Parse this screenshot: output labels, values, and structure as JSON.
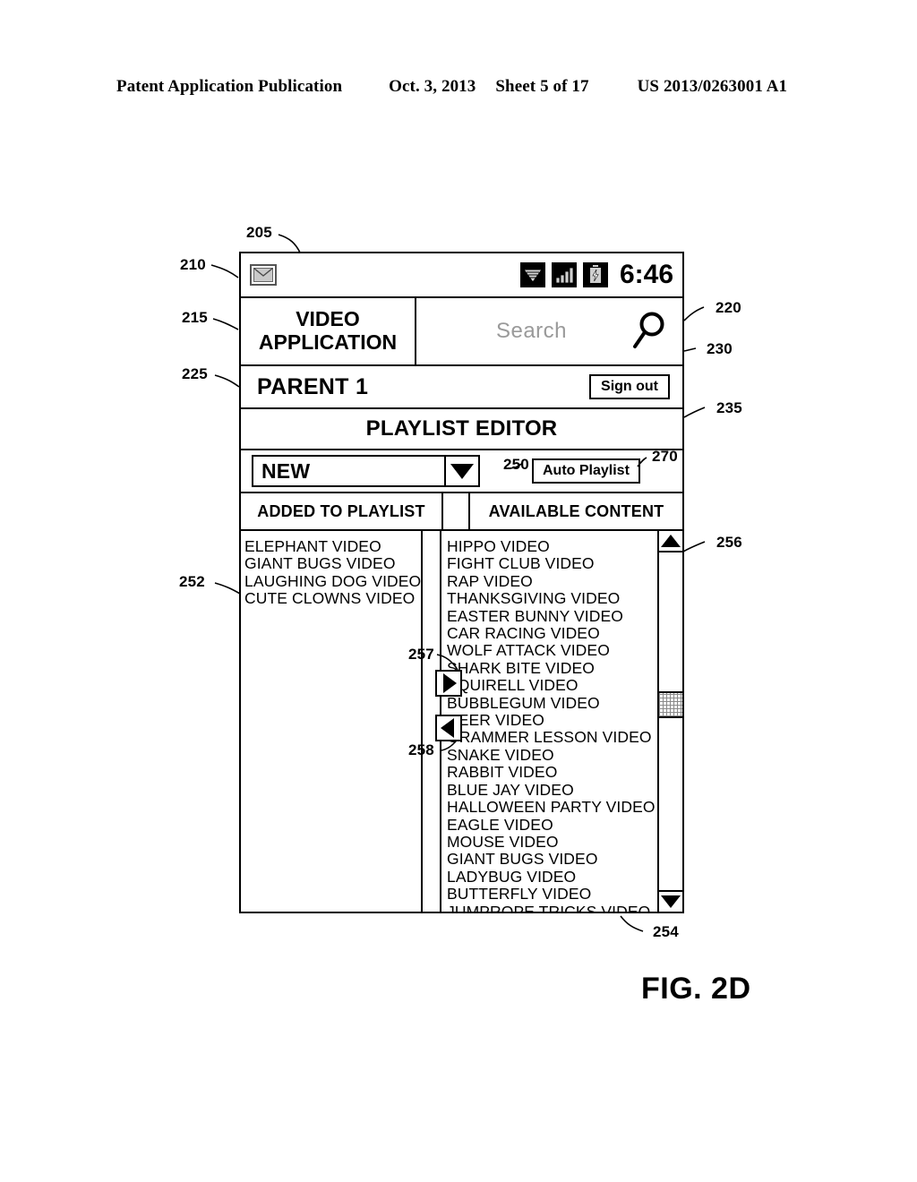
{
  "page_header": {
    "publication": "Patent Application Publication",
    "date": "Oct. 3, 2013",
    "sheet": "Sheet 5 of 17",
    "patent_number": "US 2013/0263001 A1"
  },
  "figure": {
    "caption": "FIG. 2D"
  },
  "device": {
    "statusbar": {
      "mail_icon": "mail-icon",
      "wifi_icon": "wifi-icon",
      "signal_icon": "signal-bars-icon",
      "battery_icon": "battery-charging-icon",
      "time": "6:46"
    },
    "app": {
      "title_line1": "VIDEO",
      "title_line2": "APPLICATION",
      "search_placeholder": "Search",
      "search_value": "",
      "search_icon": "magnifier-icon"
    },
    "user": {
      "name": "PARENT 1",
      "sign_out_label": "Sign out"
    },
    "section": {
      "title": "PLAYLIST EDITOR"
    },
    "selector": {
      "playlist_value": "NEW",
      "dropdown_icon": "chevron-down-icon",
      "auto_playlist_label": "Auto Playlist"
    },
    "columns": {
      "left_header": "ADDED TO PLAYLIST",
      "right_header": "AVAILABLE CONTENT"
    },
    "added_to_playlist": [
      "ELEPHANT VIDEO",
      "GIANT BUGS VIDEO",
      "LAUGHING DOG VIDEO",
      "CUTE CLOWNS VIDEO"
    ],
    "available_content": [
      "HIPPO VIDEO",
      "FIGHT CLUB VIDEO",
      "RAP VIDEO",
      "THANKSGIVING VIDEO",
      "EASTER BUNNY VIDEO",
      "CAR RACING VIDEO",
      "WOLF ATTACK VIDEO",
      "SHARK BITE VIDEO",
      "SQUIRELL VIDEO",
      "BUBBLEGUM VIDEO",
      "DEER VIDEO",
      "GRAMMER LESSON VIDEO",
      "SNAKE VIDEO",
      "RABBIT VIDEO",
      "BLUE JAY VIDEO",
      "HALLOWEEN PARTY VIDEO",
      "EAGLE VIDEO",
      "MOUSE VIDEO",
      "GIANT BUGS VIDEO",
      "LADYBUG VIDEO",
      "BUTTERFLY VIDEO",
      "JUMPROPE TRICKS VIDEO"
    ],
    "transfer": {
      "add_icon": "arrow-right-icon",
      "remove_icon": "arrow-left-icon"
    },
    "scrollbar": {
      "up_icon": "arrow-up-icon",
      "down_icon": "arrow-down-icon",
      "thumb": "scrollbar-thumb"
    }
  },
  "reference_numerals": {
    "n205": "205",
    "n210": "210",
    "n215": "215",
    "n220": "220",
    "n225": "225",
    "n230": "230",
    "n235": "235",
    "n250": "250",
    "n252": "252",
    "n254": "254",
    "n256": "256",
    "n257": "257",
    "n258": "258",
    "n270": "270"
  }
}
